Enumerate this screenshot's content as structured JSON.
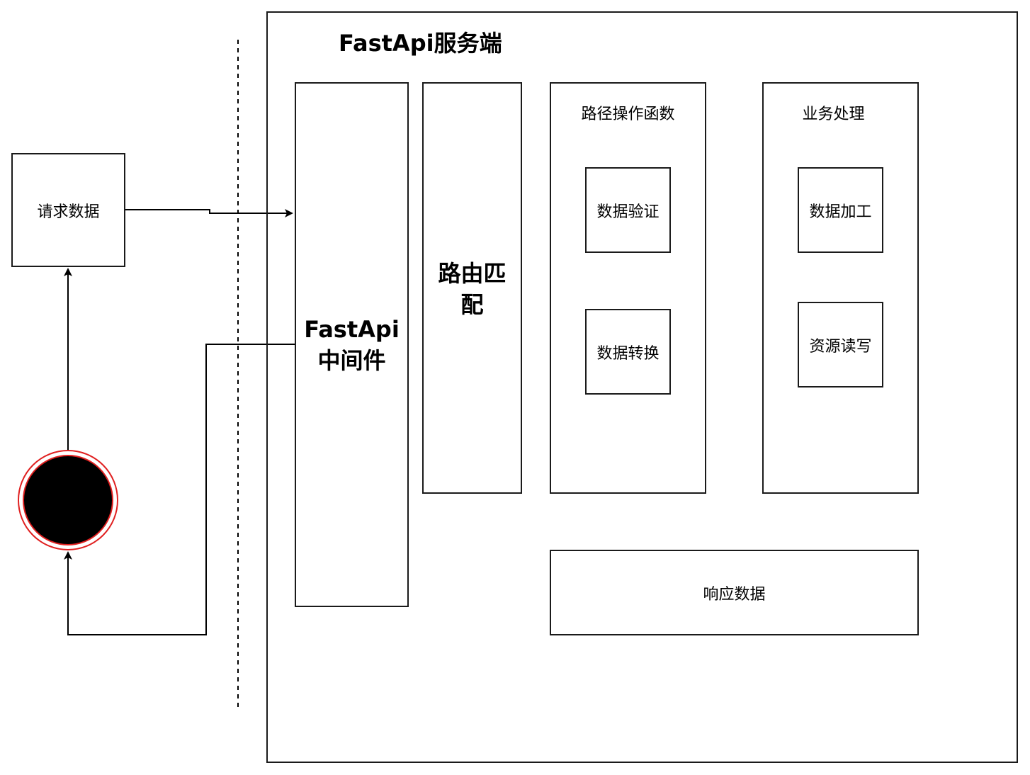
{
  "client": {
    "request_label": "请求数据"
  },
  "server": {
    "title": "FastApi服务端",
    "middleware_label": "FastApi\n中间件",
    "routing_label": "路由匹\n配",
    "path_ops": {
      "title": "路径操作函数",
      "validate_label": "数据验证",
      "convert_label": "数据转换"
    },
    "business": {
      "title": "业务处理",
      "process_label": "数据加工",
      "io_label": "资源读写"
    },
    "response_label": "响应数据"
  },
  "colors": {
    "stroke": "#1a1a1a",
    "terminal_fill": "#000000",
    "terminal_ring": "#e02020"
  }
}
